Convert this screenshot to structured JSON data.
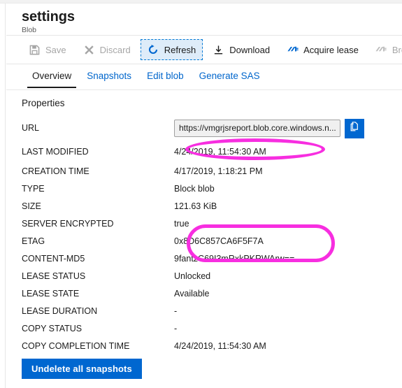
{
  "header": {
    "title": "settings",
    "subtitle": "Blob"
  },
  "commandbar": {
    "items": [
      {
        "label": "Save",
        "icon": "save-icon",
        "state": "disabled"
      },
      {
        "label": "Discard",
        "icon": "discard-icon",
        "state": "disabled"
      },
      {
        "label": "Refresh",
        "icon": "refresh-icon",
        "state": "focused"
      },
      {
        "label": "Download",
        "icon": "download-icon",
        "state": "enabled"
      },
      {
        "label": "Acquire lease",
        "icon": "lease-icon",
        "state": "enabled"
      },
      {
        "label": "Break lease",
        "icon": "break-lease-icon",
        "state": "disabled"
      }
    ]
  },
  "tabs": [
    {
      "label": "Overview",
      "active": true
    },
    {
      "label": "Snapshots",
      "active": false
    },
    {
      "label": "Edit blob",
      "active": false
    },
    {
      "label": "Generate SAS",
      "active": false
    }
  ],
  "properties": {
    "section_title": "Properties",
    "url": {
      "label": "URL",
      "value": "https://vmgrjsreport.blob.core.windows.n...",
      "copy_icon": "copy-icon"
    },
    "rows": [
      {
        "label": "LAST MODIFIED",
        "value": "4/24/2019, 11:54:30 AM"
      },
      {
        "label": "CREATION TIME",
        "value": "4/17/2019, 1:18:21 PM"
      },
      {
        "label": "TYPE",
        "value": "Block blob"
      },
      {
        "label": "SIZE",
        "value": "121.63 KiB"
      },
      {
        "label": "SERVER ENCRYPTED",
        "value": "true"
      },
      {
        "label": "ETAG",
        "value": "0x8D6C857CA6F5F7A"
      },
      {
        "label": "CONTENT-MD5",
        "value": "9fantzC69I3mRxkPKRWArw=="
      },
      {
        "label": "LEASE STATUS",
        "value": "Unlocked"
      },
      {
        "label": "LEASE STATE",
        "value": "Available"
      },
      {
        "label": "LEASE DURATION",
        "value": "-"
      },
      {
        "label": "COPY STATUS",
        "value": "-"
      },
      {
        "label": "COPY COMPLETION TIME",
        "value": "4/24/2019, 11:54:30 AM"
      }
    ]
  },
  "footer": {
    "undelete_label": "Undelete all snapshots"
  },
  "annotations": [
    {
      "name": "last-modified-highlight",
      "color": "#f72ee0"
    },
    {
      "name": "etag-md5-highlight",
      "color": "#f72ee0"
    }
  ],
  "colors": {
    "accent": "#0067d0",
    "link": "#0066cc",
    "annotation": "#f72ee0",
    "disabled_text": "#a6a6a6",
    "focus_fill": "#deecf9"
  }
}
